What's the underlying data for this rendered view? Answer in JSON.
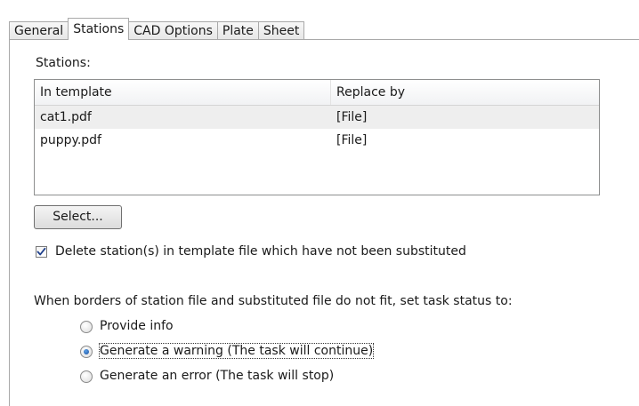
{
  "tabs": [
    {
      "label": "General",
      "active": false
    },
    {
      "label": "Stations",
      "active": true
    },
    {
      "label": "CAD Options",
      "active": false
    },
    {
      "label": "Plate",
      "active": false
    },
    {
      "label": "Sheet",
      "active": false
    }
  ],
  "stations": {
    "label": "Stations:",
    "columns": [
      "In template",
      "Replace by"
    ],
    "rows": [
      {
        "in_template": "cat1.pdf",
        "replace_by": "[File]",
        "selected": true
      },
      {
        "in_template": "puppy.pdf",
        "replace_by": "[File]",
        "selected": false
      }
    ],
    "select_button": "Select..."
  },
  "delete_stations": {
    "label": "Delete station(s) in template file which have not been substituted",
    "checked": true
  },
  "border_status": {
    "label": "When borders of station file and substituted file do not fit, set task status to:",
    "options": [
      {
        "label": "Provide info",
        "selected": false
      },
      {
        "label": "Generate a warning (The task will continue)",
        "selected": true
      },
      {
        "label": "Generate an error (The task will stop)",
        "selected": false
      }
    ]
  },
  "colors": {
    "selected_row": "#eeeeee",
    "radio_dot": "#1b4f9c",
    "check_mark": "#1e3f8c"
  }
}
